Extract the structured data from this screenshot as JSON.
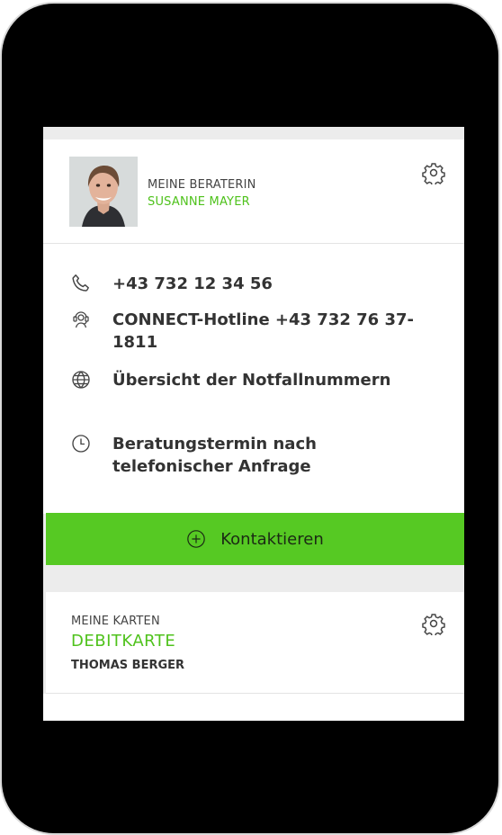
{
  "advisor": {
    "label": "MEINE BERATERIN",
    "name": "SUSANNE MAYER"
  },
  "contacts": {
    "phone": "+43 732 12 34 56",
    "hotline": "CONNECT-Hotline +43 732 76 37-1811",
    "emergency": "Übersicht der Notfallnummern",
    "appointment": "Beratungstermin nach telefonischer Anfrage"
  },
  "contact_button": {
    "label": "Kontaktieren"
  },
  "cards": {
    "label": "MEINE KARTEN",
    "type": "DEBITKARTE",
    "owner": "THOMAS BERGER"
  },
  "icons": {
    "settings": "gear-icon",
    "phone": "phone-icon",
    "hotline": "headset-icon",
    "emergency": "globe-icon",
    "appointment": "clock-icon",
    "add": "plus-circle-icon"
  },
  "colors": {
    "accent": "#56c923",
    "accent_text": "#4fc21c",
    "text": "#333333",
    "muted": "#444444"
  }
}
